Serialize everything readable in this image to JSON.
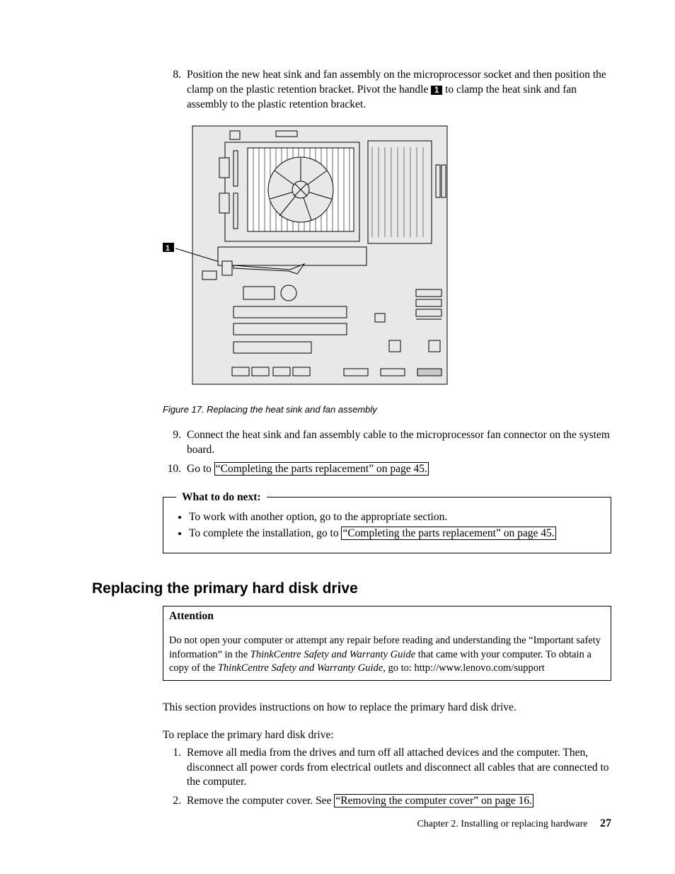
{
  "steps_a": [
    {
      "num": "8.",
      "text_a": "Position the new heat sink and fan assembly on the microprocessor socket and then position the clamp on the plastic retention bracket. Pivot the handle ",
      "callout": "1",
      "text_b": " to clamp the heat sink and fan assembly to the plastic retention bracket."
    }
  ],
  "figure": {
    "callout": "1",
    "caption": "Figure 17. Replacing the heat sink and fan assembly"
  },
  "steps_b": [
    {
      "num": "9.",
      "text": "Connect the heat sink and fan assembly cable to the microprocessor fan connector on the system board."
    },
    {
      "num": "10.",
      "text_a": "Go to ",
      "xref": "“Completing the parts replacement” on page 45."
    }
  ],
  "wtd": {
    "legend": "What to do next:",
    "items": [
      {
        "text": "To work with another option, go to the appropriate section."
      },
      {
        "text_a": "To complete the installation, go to ",
        "xref": "“Completing the parts replacement” on page 45."
      }
    ]
  },
  "section_title": "Replacing the primary hard disk drive",
  "attention": {
    "title": "Attention",
    "body_a": "Do not open your computer or attempt any repair before reading and understanding the “Important safety information” in the ",
    "italic_a": "ThinkCentre Safety and Warranty Guide",
    "body_b": " that came with your computer. To obtain a copy of the ",
    "italic_b": "ThinkCentre Safety and Warranty Guide",
    "body_c": ", go to: http://www.lenovo.com/support"
  },
  "section_intro": "This section provides instructions on how to replace the primary hard disk drive.",
  "section_lead": "To replace the primary hard disk drive:",
  "steps_c": [
    {
      "num": "1.",
      "text": "Remove all media from the drives and turn off all attached devices and the computer. Then, disconnect all power cords from electrical outlets and disconnect all cables that are connected to the computer."
    },
    {
      "num": "2.",
      "text_a": "Remove the computer cover. See ",
      "xref": "“Removing the computer cover” on page 16."
    }
  ],
  "footer": {
    "chapter": "Chapter 2. Installing or replacing hardware",
    "page": "27"
  }
}
